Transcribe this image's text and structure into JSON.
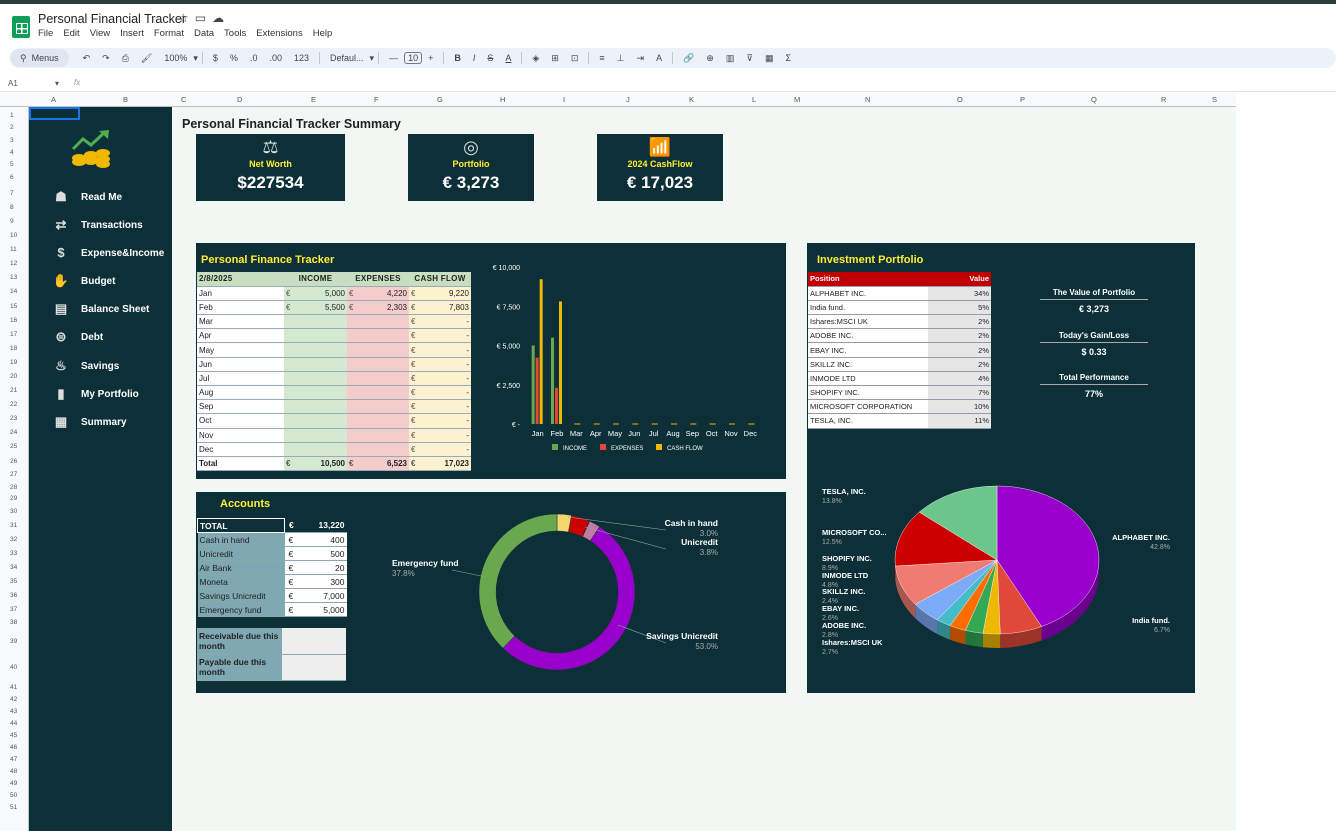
{
  "app": {
    "title": "Personal Financial Tracker",
    "menus": [
      "File",
      "Edit",
      "View",
      "Insert",
      "Format",
      "Data",
      "Tools",
      "Extensions",
      "Help"
    ],
    "toolbar": {
      "search": "Menus",
      "zoom": "100%",
      "currency": "$",
      "percent": "%",
      "dec_less": ".0",
      "dec_more": ".00",
      "num_format": "123",
      "font": "Defaul...",
      "font_size": "10"
    },
    "cell_ref": "A1",
    "fx": "fx"
  },
  "columns": [
    "A",
    "B",
    "C",
    "D",
    "E",
    "F",
    "G",
    "H",
    "I",
    "J",
    "K",
    "L",
    "M",
    "N",
    "O",
    "P",
    "Q",
    "R",
    "S"
  ],
  "rows": [
    "1",
    "2",
    "3",
    "4",
    "5",
    "6",
    "7",
    "8",
    "9",
    "10",
    "11",
    "12",
    "13",
    "14",
    "15",
    "16",
    "17",
    "18",
    "19",
    "20",
    "21",
    "22",
    "23",
    "24",
    "25",
    "26",
    "27",
    "28",
    "29",
    "30",
    "31",
    "32",
    "33",
    "34",
    "35",
    "36",
    "37",
    "38",
    "39",
    "40",
    "41",
    "42",
    "43",
    "44",
    "45",
    "46",
    "47",
    "48",
    "49",
    "50",
    "51"
  ],
  "sidebar": {
    "items": [
      {
        "label": "Read Me",
        "icon": "user-book-icon"
      },
      {
        "label": "Transactions",
        "icon": "transactions-icon"
      },
      {
        "label": "Expense&Income",
        "icon": "coin-dollar-icon"
      },
      {
        "label": "Budget",
        "icon": "budget-hand-icon"
      },
      {
        "label": "Balance Sheet",
        "icon": "balance-sheet-icon"
      },
      {
        "label": "Debt",
        "icon": "debt-icon"
      },
      {
        "label": "Savings",
        "icon": "piggy-bank-icon"
      },
      {
        "label": "My Portfolio",
        "icon": "portfolio-chart-icon"
      },
      {
        "label": "Summary",
        "icon": "summary-chart-icon"
      }
    ]
  },
  "summary": {
    "heading": "Personal Financial Tracker Summary",
    "kpis": [
      {
        "label": "Net Worth",
        "value": "$227534"
      },
      {
        "label": "Portfolio",
        "value": "€ 3,273"
      },
      {
        "label": "2024 CashFlow",
        "value": "€ 17,023"
      }
    ]
  },
  "tracker": {
    "title": "Personal Finance Tracker",
    "date": "2/8/2025",
    "headers": [
      "INCOME",
      "EXPENSES",
      "CASH FLOW"
    ],
    "currency": "€",
    "rows": [
      {
        "m": "Jan",
        "i": "5,000",
        "e": "4,220",
        "c": "9,220"
      },
      {
        "m": "Feb",
        "i": "5,500",
        "e": "2,303",
        "c": "7,803"
      },
      {
        "m": "Mar",
        "i": "",
        "e": "",
        "c": "-"
      },
      {
        "m": "Apr",
        "i": "",
        "e": "",
        "c": "-"
      },
      {
        "m": "May",
        "i": "",
        "e": "",
        "c": "-"
      },
      {
        "m": "Jun",
        "i": "",
        "e": "",
        "c": "-"
      },
      {
        "m": "Jul",
        "i": "",
        "e": "",
        "c": "-"
      },
      {
        "m": "Aug",
        "i": "",
        "e": "",
        "c": "-"
      },
      {
        "m": "Sep",
        "i": "",
        "e": "",
        "c": "-"
      },
      {
        "m": "Oct",
        "i": "",
        "e": "",
        "c": "-"
      },
      {
        "m": "Nov",
        "i": "",
        "e": "",
        "c": "-"
      },
      {
        "m": "Dec",
        "i": "",
        "e": "",
        "c": "-"
      }
    ],
    "total": {
      "m": "Total",
      "i": "10,500",
      "e": "6,523",
      "c": "17,023"
    }
  },
  "chart_data": [
    {
      "type": "bar",
      "categories": [
        "Jan",
        "Feb",
        "Mar",
        "Apr",
        "May",
        "Jun",
        "Jul",
        "Aug",
        "Sep",
        "Oct",
        "Nov",
        "Dec"
      ],
      "series": [
        {
          "name": "INCOME",
          "color": "#6aa84f",
          "values": [
            5000,
            5500,
            0,
            0,
            0,
            0,
            0,
            0,
            0,
            0,
            0,
            0
          ]
        },
        {
          "name": "EXPENSES",
          "color": "#e0483a",
          "values": [
            4220,
            2303,
            0,
            0,
            0,
            0,
            0,
            0,
            0,
            0,
            0,
            0
          ]
        },
        {
          "name": "CASH FLOW",
          "color": "#f1b800",
          "values": [
            9220,
            7803,
            0,
            0,
            0,
            0,
            0,
            0,
            0,
            0,
            0,
            0
          ]
        }
      ],
      "y_ticks": [
        "€ 10,000",
        "€ 7,500",
        "€ 5,000",
        "€ 2,500",
        "€ -"
      ],
      "ylim": [
        0,
        10000
      ],
      "legend": "bottom"
    },
    {
      "type": "pie",
      "donut": true,
      "slices": [
        {
          "label": "Cash in hand",
          "pct": "3.0%",
          "value": 3.0,
          "color": "#f5d76e"
        },
        {
          "label": "Unicredit",
          "pct": "3.8%",
          "value": 3.8,
          "color": "#cc0000"
        },
        {
          "label": "",
          "value": 0.1,
          "color": "#ff9999"
        },
        {
          "label": "",
          "value": 2.3,
          "color": "#c27ba0"
        },
        {
          "label": "Savings Unicredit",
          "pct": "53.0%",
          "value": 53.0,
          "color": "#9900cc"
        },
        {
          "label": "Emergency fund",
          "pct": "37.8%",
          "value": 37.8,
          "color": "#6aa84f"
        }
      ]
    },
    {
      "type": "pie",
      "three_d": true,
      "slices": [
        {
          "label": "ALPHABET INC.",
          "pct": "42.8%",
          "value": 42.8,
          "color": "#9900cc"
        },
        {
          "label": "India fund.",
          "pct": "6.7%",
          "value": 6.7,
          "color": "#e0483a"
        },
        {
          "label": "Ishares:MSCI UK",
          "pct": "2.7%",
          "value": 2.7,
          "color": "#f1b800"
        },
        {
          "label": "ADOBE INC.",
          "pct": "2.8%",
          "value": 2.8,
          "color": "#34a853"
        },
        {
          "label": "EBAY INC.",
          "pct": "2.6%",
          "value": 2.6,
          "color": "#ff6d01"
        },
        {
          "label": "SKILLZ INC.",
          "pct": "2.4%",
          "value": 2.4,
          "color": "#46bdc6"
        },
        {
          "label": "INMODE LTD",
          "pct": "4.8%",
          "value": 4.8,
          "color": "#7baaf7"
        },
        {
          "label": "SHOPIFY INC.",
          "pct": "8.9%",
          "value": 8.9,
          "color": "#f07b72"
        },
        {
          "label": "MICROSOFT CO...",
          "pct": "12.5%",
          "value": 12.5,
          "color": "#cc0000"
        },
        {
          "label": "TESLA, INC.",
          "pct": "13.8%",
          "value": 13.8,
          "color": "#6cc58b"
        }
      ]
    }
  ],
  "accounts": {
    "title": "Accounts",
    "total": {
      "n": "TOTAL",
      "v": "13,220"
    },
    "rows": [
      {
        "n": "Cash in hand",
        "v": "400"
      },
      {
        "n": "Unicredit",
        "v": "500"
      },
      {
        "n": "Air Bank",
        "v": "20"
      },
      {
        "n": "Moneta",
        "v": "300"
      },
      {
        "n": "Savings Unicredit",
        "v": "7,000"
      },
      {
        "n": "Emergency fund",
        "v": "5,000"
      }
    ],
    "receivable": "Receivable due this month",
    "payable": "Payable due this month"
  },
  "portfolio": {
    "title": "Investment Portfolio",
    "headers": [
      "Position",
      "Value"
    ],
    "rows": [
      {
        "n": "ALPHABET INC.",
        "v": "34%"
      },
      {
        "n": "India fund.",
        "v": "5%"
      },
      {
        "n": "Ishares:MSCI UK",
        "v": "2%"
      },
      {
        "n": "ADOBE INC.",
        "v": "2%"
      },
      {
        "n": "EBAY INC.",
        "v": "2%"
      },
      {
        "n": "SKILLZ INC.",
        "v": "2%"
      },
      {
        "n": "INMODE LTD",
        "v": "4%"
      },
      {
        "n": "SHOPIFY INC.",
        "v": "7%"
      },
      {
        "n": "MICROSOFT CORPORATION",
        "v": "10%"
      },
      {
        "n": "TESLA, INC.",
        "v": "11%"
      }
    ],
    "stats": [
      {
        "label": "The Value of Portfolio",
        "value": "€ 3,273"
      },
      {
        "label": "Today's Gain/Loss",
        "value": "$ 0.33"
      },
      {
        "label": "Total Performance",
        "value": "77%"
      }
    ]
  }
}
